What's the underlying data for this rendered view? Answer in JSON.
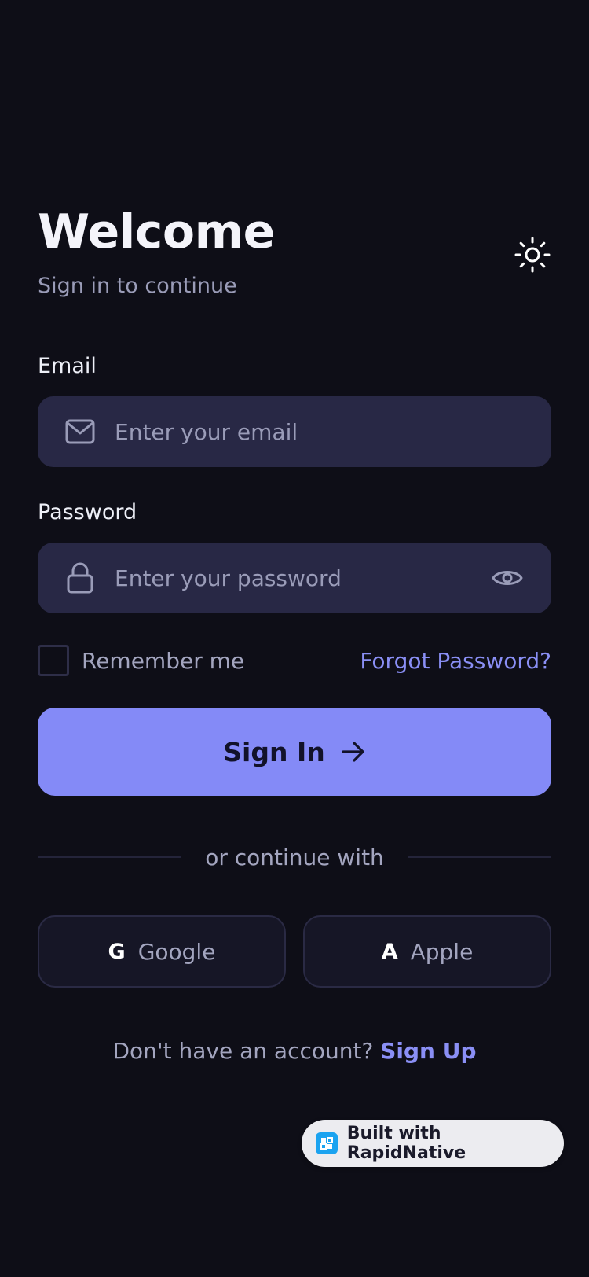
{
  "header": {
    "title": "Welcome",
    "subtitle": "Sign in to continue"
  },
  "theme_toggle": {
    "icon": "sun-icon"
  },
  "email": {
    "label": "Email",
    "placeholder": "Enter your email",
    "value": "",
    "icon": "mail-icon"
  },
  "password": {
    "label": "Password",
    "placeholder": "Enter your password",
    "value": "",
    "icon": "lock-icon",
    "toggle_icon": "eye-icon"
  },
  "remember": {
    "label": "Remember me",
    "checked": false
  },
  "forgot_label": "Forgot Password?",
  "signin": {
    "label": "Sign In",
    "icon": "arrow-right-icon"
  },
  "divider_text": "or continue with",
  "social": [
    {
      "glyph": "G",
      "label": "Google"
    },
    {
      "glyph": "A",
      "label": "Apple"
    }
  ],
  "signup": {
    "prompt": "Don't have an account?",
    "link": "Sign Up"
  },
  "badge": {
    "text": "Built with RapidNative"
  },
  "colors": {
    "background": "#0e0e17",
    "field": "#282845",
    "accent": "#848af7",
    "link": "#8a8ff5",
    "muted_text": "#9a9cb8"
  }
}
